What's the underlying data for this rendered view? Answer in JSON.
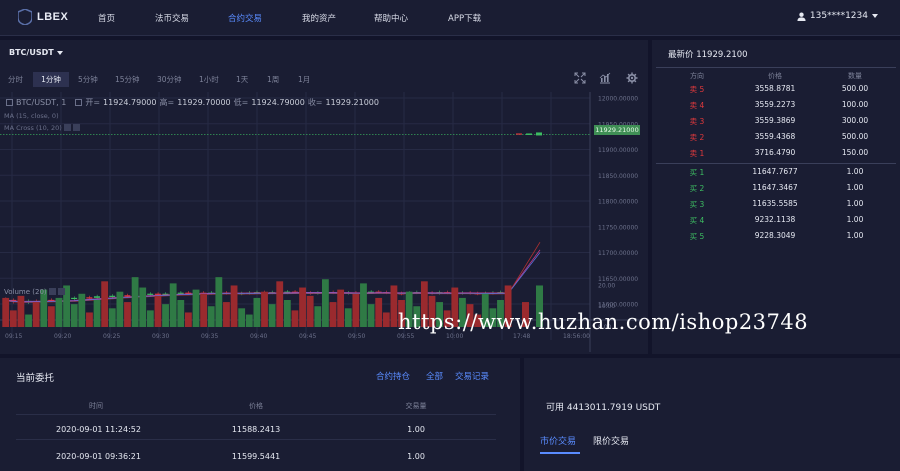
{
  "nav": {
    "logo": "LBEX",
    "items": [
      "首页",
      "法币交易",
      "合约交易",
      "我的资产",
      "帮助中心",
      "APP下载"
    ],
    "active_index": 2,
    "user": "135****1234"
  },
  "chart": {
    "pair": "BTC/USDT",
    "intervals": [
      "分时",
      "1分钟",
      "5分钟",
      "15分钟",
      "30分钟",
      "1小时",
      "1天",
      "1周",
      "1月"
    ],
    "active_interval": 1,
    "header_pair": "BTC/USDT, 1",
    "open_label": "开=",
    "open": "11924.79000",
    "high_label": "高=",
    "high": "11929.70000",
    "low_label": "低=",
    "low": "11924.79000",
    "close_label": "收=",
    "close": "11929.21000",
    "ma_label": "MA (15, close, 0)",
    "macross_label": "MA Cross (10, 20)",
    "volume_label": "Volume (20)",
    "current_price_tag": "11929.21000"
  },
  "chart_data": {
    "type": "candlestick",
    "price_axis_ticks": [
      "12000.00000",
      "11950.00000",
      "11900.00000",
      "11850.00000",
      "11800.00000",
      "11750.00000",
      "11700.00000",
      "11650.00000",
      "11600.00000"
    ],
    "volume_axis_ticks": [
      "20.00",
      "10.00",
      "0.00"
    ],
    "time_ticks": [
      "09:15",
      "09:20",
      "09:25",
      "09:30",
      "09:35",
      "09:40",
      "09:45",
      "09:50",
      "09:55",
      "10:00",
      "17:48",
      "18:56:00"
    ],
    "candles_close": [
      11608,
      11604,
      11603,
      11606,
      11605,
      11608,
      11607,
      11609,
      11610,
      11612,
      11613,
      11612,
      11615,
      11614,
      11616,
      11617,
      11616,
      11618,
      11619,
      11620,
      11619,
      11620,
      11621,
      11622,
      11621,
      11622,
      11621,
      11622,
      11622,
      11621,
      11620,
      11621,
      11622,
      11623,
      11622,
      11623,
      11622,
      11624,
      11623,
      11622,
      11621,
      11622,
      11623,
      11622,
      11621,
      11622,
      11621,
      11623,
      11624,
      11623,
      11622,
      11621,
      11620,
      11622,
      11623,
      11622,
      11621,
      11623,
      11622,
      11621,
      11622,
      11621,
      11620,
      11621,
      11622,
      11623,
      11622
    ],
    "volumes": [
      14,
      8,
      15,
      6,
      12,
      18,
      10,
      14,
      20,
      11,
      16,
      7,
      13,
      22,
      9,
      17,
      12,
      24,
      19,
      8,
      15,
      11,
      21,
      13,
      7,
      18,
      16,
      10,
      24,
      12,
      20,
      9,
      6,
      14,
      17,
      11,
      22,
      13,
      8,
      19,
      15,
      10,
      23,
      12,
      18,
      9,
      16,
      21,
      11,
      14,
      7,
      20,
      13,
      17,
      10,
      22,
      15,
      12,
      8,
      19,
      14,
      11,
      6,
      16,
      9,
      13,
      20
    ]
  },
  "book": {
    "latest_label": "最新价",
    "latest_price": "11929.2100",
    "headers": [
      "方向",
      "价格",
      "数量"
    ],
    "asks": [
      {
        "side": "卖 5",
        "price": "3558.8781",
        "qty": "500.00"
      },
      {
        "side": "卖 4",
        "price": "3559.2273",
        "qty": "100.00"
      },
      {
        "side": "卖 3",
        "price": "3559.3869",
        "qty": "300.00"
      },
      {
        "side": "卖 2",
        "price": "3559.4368",
        "qty": "500.00"
      },
      {
        "side": "卖 1",
        "price": "3716.4790",
        "qty": "150.00"
      }
    ],
    "bids": [
      {
        "side": "买 1",
        "price": "11647.7677",
        "qty": "1.00"
      },
      {
        "side": "买 2",
        "price": "11647.3467",
        "qty": "1.00"
      },
      {
        "side": "买 3",
        "price": "11635.5585",
        "qty": "1.00"
      },
      {
        "side": "买 4",
        "price": "9232.1138",
        "qty": "1.00"
      },
      {
        "side": "买 5",
        "price": "9228.3049",
        "qty": "1.00"
      }
    ]
  },
  "orders": {
    "title": "当前委托",
    "links": [
      "合约持仓",
      "全部",
      "交易记录"
    ],
    "headers": [
      "时间",
      "价格",
      "交易量"
    ],
    "rows": [
      {
        "time": "2020-09-01 11:24:52",
        "price": "11588.2413",
        "qty": "1.00"
      },
      {
        "time": "2020-09-01 09:36:21",
        "price": "11599.5441",
        "qty": "1.00"
      }
    ]
  },
  "trade": {
    "available": "可用 4413011.7919 USDT",
    "tabs": [
      "市价交易",
      "限价交易"
    ]
  },
  "watermark": "https://www.huzhan.com/ishop23748",
  "colors": {
    "up": "#3dbd62",
    "down": "#e0393c",
    "accent": "#5a8cff"
  }
}
